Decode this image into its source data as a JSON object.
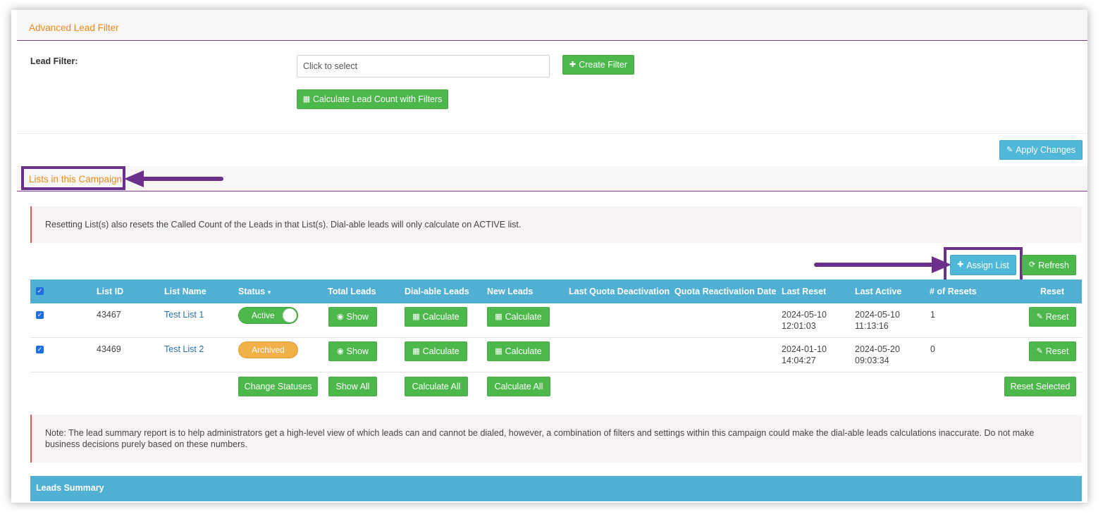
{
  "advanced_filter": {
    "section_title": "Advanced Lead Filter",
    "lead_filter_label": "Lead Filter:",
    "select_placeholder": "Click to select",
    "create_filter_label": "Create Filter",
    "calculate_label": "Calculate Lead Count with Filters"
  },
  "apply_changes_label": "Apply Changes",
  "lists_section": {
    "title": "Lists in this Campaign",
    "reset_note": "Resetting List(s) also resets the Called Count of the Leads in that List(s). Dial-able leads will only calculate on ACTIVE list.",
    "assign_list_label": "Assign List",
    "refresh_label": "Refresh"
  },
  "table": {
    "headers": {
      "list_id": "List ID",
      "list_name": "List Name",
      "status": "Status",
      "total_leads": "Total Leads",
      "dialable_leads": "Dial-able Leads",
      "new_leads": "New Leads",
      "last_quota_deactivation": "Last Quota Deactivation",
      "quota_reactivation_date": "Quota Reactivation Date",
      "last_reset": "Last Reset",
      "last_active": "Last Active",
      "num_resets": "# of Resets",
      "reset": "Reset"
    },
    "rows": [
      {
        "list_id": "43467",
        "list_name": "Test List 1",
        "status": "Active",
        "total_leads_btn": "Show",
        "dialable_btn": "Calculate",
        "new_leads_btn": "Calculate",
        "last_reset_date": "2024-05-10",
        "last_reset_time": "12:01:03",
        "last_active_date": "2024-05-10",
        "last_active_time": "11:13:16",
        "num_resets": "1",
        "reset_btn": "Reset"
      },
      {
        "list_id": "43469",
        "list_name": "Test List 2",
        "status": "Archived",
        "total_leads_btn": "Show",
        "dialable_btn": "Calculate",
        "new_leads_btn": "Calculate",
        "last_reset_date": "2024-01-10",
        "last_reset_time": "14:04:27",
        "last_active_date": "2024-05-20",
        "last_active_time": "09:03:34",
        "num_resets": "0",
        "reset_btn": "Reset"
      }
    ],
    "footer": {
      "change_statuses": "Change Statuses",
      "show_all": "Show All",
      "calculate_all_dialable": "Calculate All",
      "calculate_all_new": "Calculate All",
      "reset_selected": "Reset Selected"
    }
  },
  "summary_note": "Note: The lead summary report is to help administrators get a high-level view of which leads can and cannot be dialed, however, a combination of filters and settings within this campaign could make the dial-able leads calculations inaccurate. Do not make business decisions purely based on these numbers.",
  "leads_summary_title": "Leads Summary",
  "colors": {
    "green": "#4cb84c",
    "blue": "#4fb0d4",
    "orange_title": "#ee8a1a",
    "purple_annotation": "#6b2f8c",
    "archived": "#f2b048"
  }
}
